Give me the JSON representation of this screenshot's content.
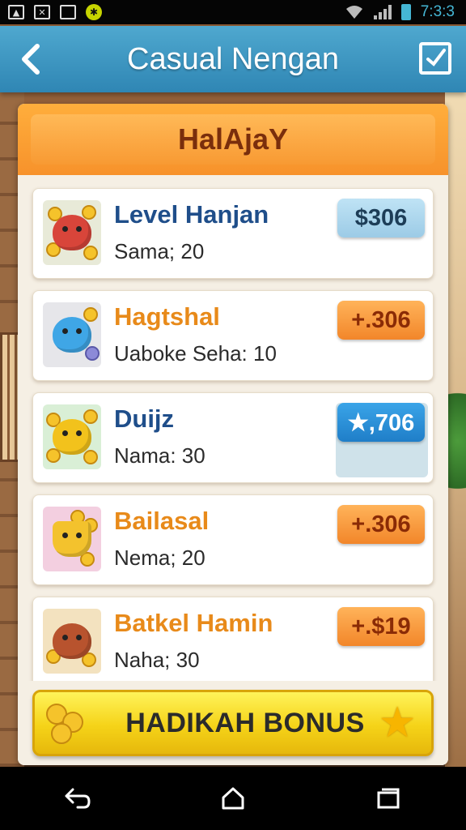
{
  "status_bar": {
    "time": "7:3:3"
  },
  "header": {
    "title": "Casual Nengan",
    "back_icon": "chevron-left-icon",
    "edit_icon": "checkbox-edit-icon"
  },
  "banner": {
    "text": "HalAjaY"
  },
  "list": {
    "items": [
      {
        "title": "Level Hanjan",
        "subtitle": "Sama; 20",
        "price": "$306",
        "title_color": "#1f4e8a",
        "price_style": "blue-light",
        "creature_color": "#d8453a",
        "thumb_bg": "#e8ead8"
      },
      {
        "title": "Hagtshal",
        "subtitle": "Uabokе Seha: 10",
        "price": "+.306",
        "title_color": "#e88a1a",
        "price_style": "orange",
        "creature_color": "#3fa6e6",
        "thumb_bg": "#e6e6ea"
      },
      {
        "title": "Duijz",
        "subtitle": "Nama: 30",
        "price": "★,706",
        "title_color": "#1f4e8a",
        "price_style": "blue",
        "creature_color": "#f2c21c",
        "thumb_bg": "#d9efd6"
      },
      {
        "title": "Bailasal",
        "subtitle": "Nema; 20",
        "price": "+.306",
        "title_color": "#e88a1a",
        "price_style": "orange",
        "creature_color": "#f3c22d",
        "thumb_bg": "#f3cfe0"
      },
      {
        "title": "Batkel Hamin",
        "subtitle": "Naha; 30",
        "price": "+.$19",
        "title_color": "#e88a1a",
        "price_style": "orange",
        "creature_color": "#b8532e",
        "thumb_bg": "#f3e2bf"
      }
    ]
  },
  "bonus": {
    "label": "HADIKAH BONUS",
    "coin_icon": "coins-icon",
    "star_icon": "star-icon"
  },
  "nav": {
    "back_icon": "back-arrow-icon",
    "home_icon": "home-icon",
    "recents_icon": "recents-icon"
  }
}
